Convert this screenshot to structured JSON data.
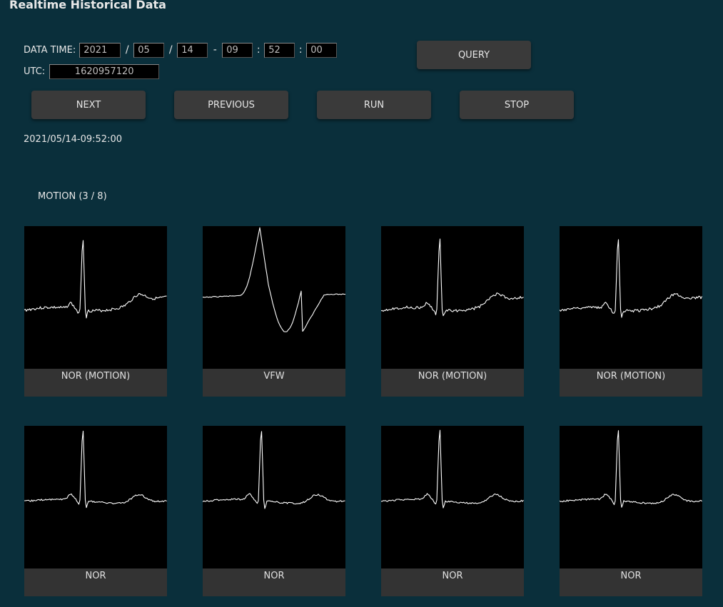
{
  "header": {
    "title": "Realtime Historical Data"
  },
  "datetime": {
    "label": "DATA TIME:",
    "year": "2021",
    "month": "05",
    "day": "14",
    "hour": "09",
    "minute": "52",
    "second": "00",
    "sep_date": "/",
    "sep_dt": "-",
    "sep_time": ":"
  },
  "utc": {
    "label": "UTC:",
    "value": "1620957120"
  },
  "buttons": {
    "query": "QUERY",
    "next": "NEXT",
    "previous": "PREVIOUS",
    "run": "RUN",
    "stop": "STOP"
  },
  "timestamp": "2021/05/14-09:52:00",
  "section": {
    "title": "MOTION (3 / 8)"
  },
  "waveforms": [
    {
      "label": "NOR (MOTION)",
      "type": "nor-motion"
    },
    {
      "label": "VFW",
      "type": "vfw"
    },
    {
      "label": "NOR (MOTION)",
      "type": "nor-motion"
    },
    {
      "label": "NOR (MOTION)",
      "type": "nor-motion"
    },
    {
      "label": "NOR",
      "type": "nor"
    },
    {
      "label": "NOR",
      "type": "nor"
    },
    {
      "label": "NOR",
      "type": "nor"
    },
    {
      "label": "NOR",
      "type": "nor"
    }
  ],
  "colors": {
    "background": "#0a2f3b",
    "button": "#3a3a3a",
    "trace": "#ffffff"
  }
}
